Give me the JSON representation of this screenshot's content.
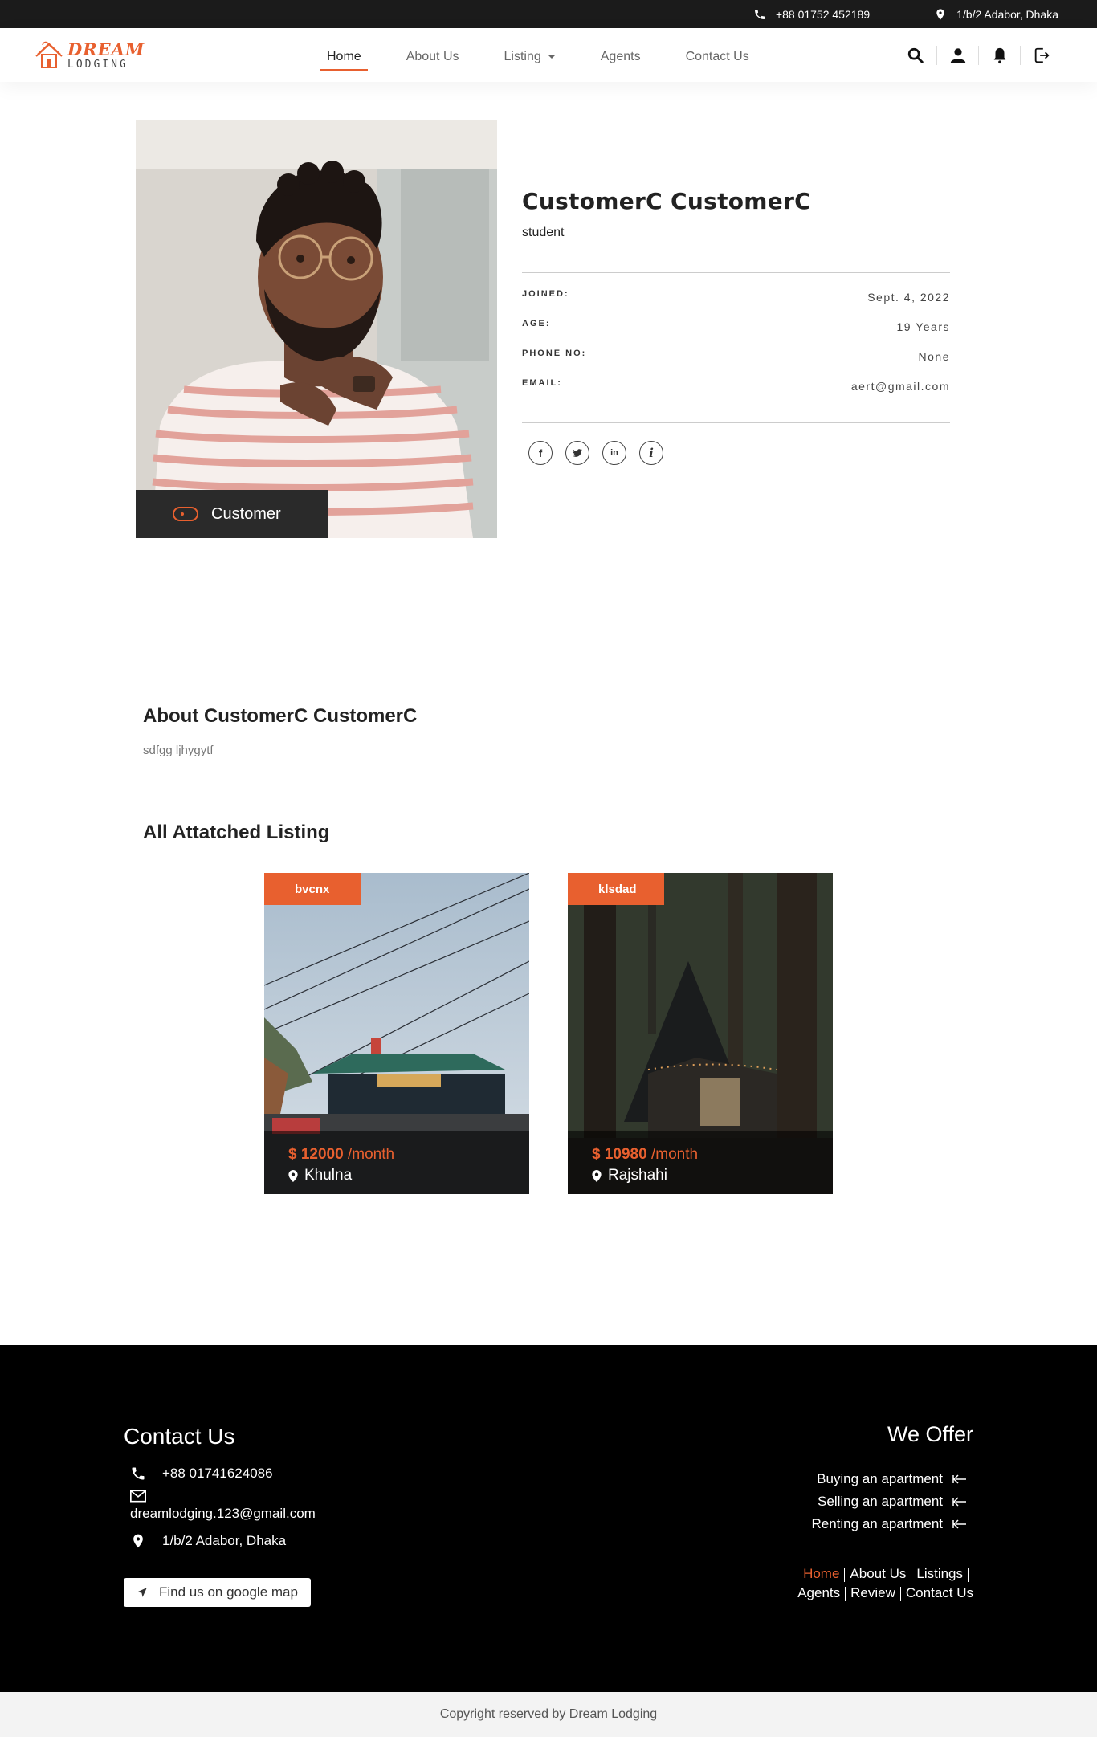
{
  "topbar": {
    "phone": "+88 01752 452189",
    "address": "1/b/2 Adabor, Dhaka"
  },
  "logo": {
    "line1": "DREAM",
    "line2": "LODGING"
  },
  "nav": {
    "home": "Home",
    "about": "About Us",
    "listing": "Listing",
    "agents": "Agents",
    "contact": "Contact Us"
  },
  "profile": {
    "name": "CustomerC CustomerC",
    "occupation": "student",
    "badge": "Customer",
    "joined_label": "JOINED:",
    "joined": "Sept. 4, 2022",
    "age_label": "AGE:",
    "age": "19 Years",
    "phone_label": "PHONE NO:",
    "phone": "None",
    "email_label": "EMAIL:",
    "email": "aert@gmail.com",
    "socials": {
      "facebook": "f",
      "linkedin": "in",
      "info": "i"
    }
  },
  "about": {
    "title": "About CustomerC CustomerC",
    "text": "sdfgg ljhygytf"
  },
  "listings": {
    "title": "All Attatched Listing",
    "items": [
      {
        "tag": "bvcnx",
        "price": "$ 12000",
        "period": "/month",
        "location": "Khulna"
      },
      {
        "tag": "klsdad",
        "price": "$ 10980",
        "period": "/month",
        "location": "Rajshahi"
      }
    ]
  },
  "footer": {
    "contact_title": "Contact Us",
    "phone": "+88 01741624086",
    "email": "dreamlodging.123@gmail.com",
    "address": "1/b/2 Adabor, Dhaka",
    "map_button": "Find us on google map",
    "offer_title": "We Offer",
    "offers": [
      "Buying an apartment",
      "Selling an apartment",
      "Renting an apartment"
    ],
    "links": {
      "home": "Home",
      "about": "About Us",
      "listings": "Listings",
      "agents": "Agents",
      "review": "Review",
      "contact": "Contact Us"
    },
    "copyright": "Copyright reserved by Dream Lodging"
  },
  "colors": {
    "accent": "#e8602f",
    "dark": "#1b1b1b",
    "footer": "#000000"
  }
}
